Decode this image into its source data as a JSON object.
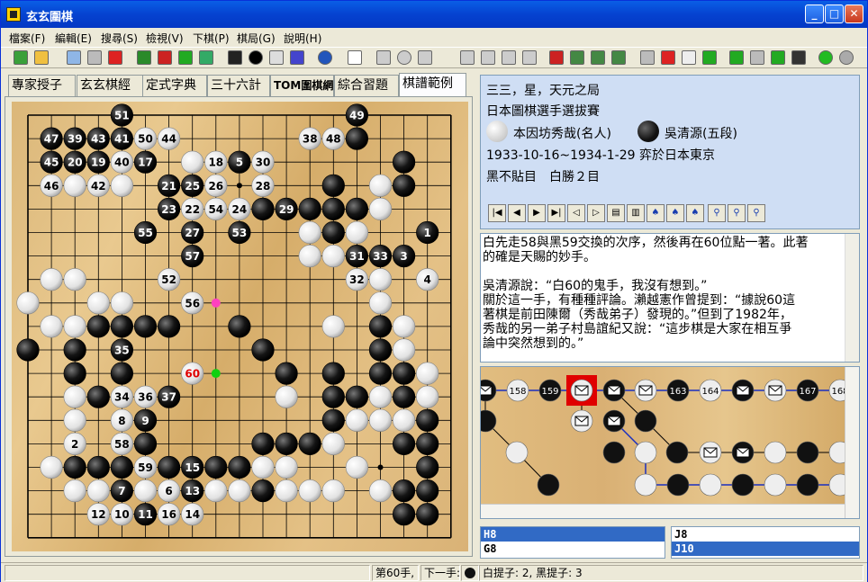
{
  "window": {
    "title": "玄玄圍棋"
  },
  "menu": [
    "檔案(F)",
    "編輯(E)",
    "搜尋(S)",
    "檢視(V)",
    "下棋(P)",
    "棋局(G)",
    "說明(H)"
  ],
  "tabs": [
    "專家授子",
    "玄玄棋經",
    "定式字典",
    "三十六計",
    "TOM圍棋網",
    "綜合習題",
    "棋譜範例"
  ],
  "active_tab": 6,
  "game_info": {
    "title": "三三，星，天元之局",
    "event": "日本圖棋選手選拔賽",
    "white_player": "本因坊秀哉(名人)",
    "black_player": "吳清源(五段)",
    "date_place": "1933-10-16~1934-1-29 弈於日本東京",
    "result": "黑不貼目　白勝２目"
  },
  "nav_icons": [
    "first-move-icon",
    "prev-move-icon",
    "next-move-icon",
    "last-move-icon",
    "prev-variation-icon",
    "next-variation-icon",
    "prev-comment-icon",
    "next-comment-icon",
    "mark-prev-icon",
    "mark-next-icon",
    "mark-branch-icon",
    "search-icon",
    "search-prev-icon",
    "search-next-icon"
  ],
  "comment": {
    "lines": [
      "白先走58與黑59交換的次序，然後再在60位點一著。此著",
      "的確是天賜的妙手。",
      "",
      "吳清源說：“白60的鬼手，我沒有想到。”",
      "關於這一手，有種種評論。瀨越憲作曾提到：“據說60這",
      "著棋是前田陳爾（秀哉弟子）發現的。”但到了1982年，",
      "秀哉的另一弟子村島誼紀又說：“這步棋是大家在相互爭",
      "論中突然想到的。”"
    ]
  },
  "tree": {
    "main_labels": [
      "158",
      "159",
      "163",
      "164",
      "167",
      "168"
    ]
  },
  "coord_list": {
    "left": [
      "H8",
      "G8"
    ],
    "right": [
      "J8",
      "J10"
    ],
    "left_selected": 0,
    "right_selected": 1
  },
  "status": {
    "move": "第60手,",
    "next_label": "下一手:",
    "captures": "白提子: 2, 黑提子: 3"
  },
  "colors": {
    "black_stone": "#111111",
    "white_stone": "#f4f4f4",
    "last_move": "#e00000",
    "selection": "#316ac5"
  },
  "board": {
    "size": 19,
    "stones": [
      [
        4,
        0,
        "b",
        51
      ],
      [
        14,
        0,
        "b",
        49
      ],
      [
        1,
        1,
        "b",
        47
      ],
      [
        2,
        1,
        "b",
        39
      ],
      [
        3,
        1,
        "b",
        43
      ],
      [
        4,
        1,
        "b",
        41
      ],
      [
        5,
        1,
        "w",
        50
      ],
      [
        6,
        1,
        "w",
        44
      ],
      [
        12,
        1,
        "w",
        38
      ],
      [
        13,
        1,
        "w",
        48
      ],
      [
        14,
        1,
        "b",
        null
      ],
      [
        1,
        2,
        "b",
        45
      ],
      [
        2,
        2,
        "b",
        20
      ],
      [
        3,
        2,
        "b",
        19
      ],
      [
        4,
        2,
        "w",
        40
      ],
      [
        5,
        2,
        "b",
        17
      ],
      [
        7,
        2,
        "w",
        null
      ],
      [
        8,
        2,
        "w",
        18
      ],
      [
        9,
        2,
        "b",
        5
      ],
      [
        10,
        2,
        "w",
        30
      ],
      [
        16,
        2,
        "b",
        null
      ],
      [
        1,
        3,
        "w",
        46
      ],
      [
        2,
        3,
        "w",
        null
      ],
      [
        3,
        3,
        "w",
        42
      ],
      [
        4,
        3,
        "w",
        null
      ],
      [
        6,
        3,
        "b",
        21
      ],
      [
        7,
        3,
        "b",
        25
      ],
      [
        8,
        3,
        "w",
        26
      ],
      [
        10,
        3,
        "w",
        28
      ],
      [
        13,
        3,
        "b",
        null
      ],
      [
        15,
        3,
        "w",
        null
      ],
      [
        16,
        3,
        "b",
        null
      ],
      [
        6,
        4,
        "b",
        23
      ],
      [
        7,
        4,
        "w",
        22
      ],
      [
        8,
        4,
        "w",
        54
      ],
      [
        9,
        4,
        "w",
        24
      ],
      [
        10,
        4,
        "b",
        null
      ],
      [
        11,
        4,
        "b",
        29
      ],
      [
        12,
        4,
        "b",
        null
      ],
      [
        13,
        4,
        "b",
        null
      ],
      [
        14,
        4,
        "b",
        null
      ],
      [
        15,
        4,
        "w",
        null
      ],
      [
        5,
        5,
        "b",
        55
      ],
      [
        7,
        5,
        "b",
        27
      ],
      [
        9,
        5,
        "b",
        53
      ],
      [
        12,
        5,
        "w",
        null
      ],
      [
        13,
        5,
        "b",
        null
      ],
      [
        14,
        5,
        "w",
        null
      ],
      [
        17,
        5,
        "b",
        1
      ],
      [
        7,
        6,
        "b",
        57
      ],
      [
        12,
        6,
        "w",
        null
      ],
      [
        13,
        6,
        "w",
        null
      ],
      [
        14,
        6,
        "b",
        31
      ],
      [
        15,
        6,
        "b",
        33
      ],
      [
        16,
        6,
        "b",
        3
      ],
      [
        1,
        7,
        "w",
        null
      ],
      [
        2,
        7,
        "w",
        null
      ],
      [
        6,
        7,
        "w",
        52
      ],
      [
        14,
        7,
        "w",
        32
      ],
      [
        15,
        7,
        "w",
        null
      ],
      [
        17,
        7,
        "w",
        4
      ],
      [
        0,
        8,
        "w",
        null
      ],
      [
        3,
        8,
        "w",
        null
      ],
      [
        4,
        8,
        "w",
        null
      ],
      [
        7,
        8,
        "w",
        56
      ],
      [
        15,
        8,
        "w",
        null
      ],
      [
        1,
        9,
        "w",
        null
      ],
      [
        2,
        9,
        "w",
        null
      ],
      [
        3,
        9,
        "b",
        null
      ],
      [
        4,
        9,
        "b",
        null
      ],
      [
        5,
        9,
        "b",
        null
      ],
      [
        6,
        9,
        "b",
        null
      ],
      [
        9,
        9,
        "b",
        null
      ],
      [
        13,
        9,
        "w",
        null
      ],
      [
        15,
        9,
        "b",
        null
      ],
      [
        16,
        9,
        "w",
        null
      ],
      [
        0,
        10,
        "b",
        null
      ],
      [
        2,
        10,
        "b",
        null
      ],
      [
        4,
        10,
        "b",
        35
      ],
      [
        10,
        10,
        "b",
        null
      ],
      [
        15,
        10,
        "b",
        null
      ],
      [
        16,
        10,
        "w",
        null
      ],
      [
        2,
        11,
        "b",
        null
      ],
      [
        4,
        11,
        "b",
        null
      ],
      [
        7,
        11,
        "w",
        60
      ],
      [
        11,
        11,
        "b",
        null
      ],
      [
        13,
        11,
        "b",
        null
      ],
      [
        15,
        11,
        "b",
        null
      ],
      [
        16,
        11,
        "b",
        null
      ],
      [
        17,
        11,
        "w",
        null
      ],
      [
        2,
        12,
        "w",
        null
      ],
      [
        3,
        12,
        "b",
        null
      ],
      [
        4,
        12,
        "w",
        34
      ],
      [
        5,
        12,
        "w",
        36
      ],
      [
        6,
        12,
        "b",
        37
      ],
      [
        11,
        12,
        "w",
        null
      ],
      [
        13,
        12,
        "b",
        null
      ],
      [
        14,
        12,
        "b",
        null
      ],
      [
        15,
        12,
        "w",
        null
      ],
      [
        16,
        12,
        "b",
        null
      ],
      [
        17,
        12,
        "w",
        null
      ],
      [
        2,
        13,
        "w",
        null
      ],
      [
        4,
        13,
        "w",
        8
      ],
      [
        5,
        13,
        "b",
        9
      ],
      [
        13,
        13,
        "b",
        null
      ],
      [
        14,
        13,
        "w",
        null
      ],
      [
        15,
        13,
        "w",
        null
      ],
      [
        16,
        13,
        "w",
        null
      ],
      [
        17,
        13,
        "b",
        null
      ],
      [
        2,
        14,
        "w",
        2
      ],
      [
        4,
        14,
        "w",
        58
      ],
      [
        5,
        14,
        "b",
        null
      ],
      [
        10,
        14,
        "b",
        null
      ],
      [
        11,
        14,
        "b",
        null
      ],
      [
        12,
        14,
        "b",
        null
      ],
      [
        13,
        14,
        "w",
        null
      ],
      [
        16,
        14,
        "b",
        null
      ],
      [
        17,
        14,
        "b",
        null
      ],
      [
        1,
        15,
        "w",
        null
      ],
      [
        2,
        15,
        "b",
        null
      ],
      [
        3,
        15,
        "b",
        null
      ],
      [
        4,
        15,
        "b",
        null
      ],
      [
        5,
        15,
        "w",
        59
      ],
      [
        6,
        15,
        "b",
        null
      ],
      [
        7,
        15,
        "b",
        15
      ],
      [
        8,
        15,
        "b",
        null
      ],
      [
        9,
        15,
        "b",
        null
      ],
      [
        10,
        15,
        "w",
        null
      ],
      [
        11,
        15,
        "w",
        null
      ],
      [
        14,
        15,
        "w",
        null
      ],
      [
        17,
        15,
        "b",
        null
      ],
      [
        2,
        16,
        "w",
        null
      ],
      [
        3,
        16,
        "w",
        null
      ],
      [
        4,
        16,
        "b",
        7
      ],
      [
        5,
        16,
        "w",
        null
      ],
      [
        6,
        16,
        "w",
        6
      ],
      [
        7,
        16,
        "b",
        13
      ],
      [
        8,
        16,
        "w",
        null
      ],
      [
        9,
        16,
        "w",
        null
      ],
      [
        10,
        16,
        "b",
        null
      ],
      [
        11,
        16,
        "w",
        null
      ],
      [
        12,
        16,
        "w",
        null
      ],
      [
        13,
        16,
        "w",
        null
      ],
      [
        15,
        16,
        "w",
        null
      ],
      [
        16,
        16,
        "b",
        null
      ],
      [
        17,
        16,
        "b",
        null
      ],
      [
        3,
        17,
        "w",
        12
      ],
      [
        4,
        17,
        "w",
        10
      ],
      [
        5,
        17,
        "b",
        11
      ],
      [
        6,
        17,
        "w",
        16
      ],
      [
        7,
        17,
        "w",
        14
      ],
      [
        16,
        17,
        "b",
        null
      ],
      [
        17,
        17,
        "b",
        null
      ]
    ],
    "markers": [
      [
        8,
        8,
        "pink"
      ],
      [
        8,
        11,
        "green"
      ],
      [
        9,
        3,
        "dot"
      ],
      [
        15,
        15,
        "dot"
      ]
    ]
  }
}
